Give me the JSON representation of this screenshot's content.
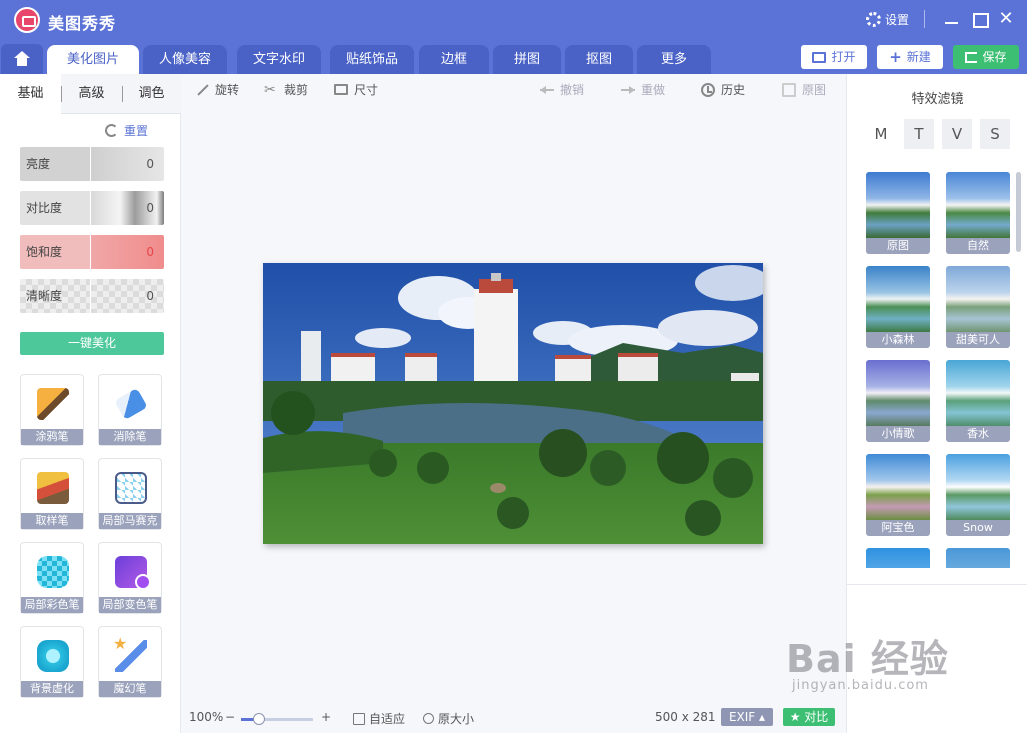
{
  "app": {
    "title": "美图秀秀",
    "settings_label": "设置",
    "close_glyph": "✕"
  },
  "tabs": [
    "美化图片",
    "人像美容",
    "文字水印",
    "贴纸饰品",
    "边框",
    "拼图",
    "抠图",
    "更多"
  ],
  "toolbar": {
    "open_label": "打开",
    "new_label": "新建",
    "save_label": "保存"
  },
  "left_panel": {
    "subtabs": [
      "基础",
      "高级",
      "调色"
    ],
    "reset_label": "重置",
    "sliders": [
      {
        "label": "亮度",
        "value": "0"
      },
      {
        "label": "对比度",
        "value": "0"
      },
      {
        "label": "饱和度",
        "value": "0"
      },
      {
        "label": "清晰度",
        "value": "0"
      }
    ],
    "beautify_label": "一键美化",
    "tools": [
      "涂鸦笔",
      "消除笔",
      "取样笔",
      "局部马赛克",
      "局部彩色笔",
      "局部变色笔",
      "背景虚化",
      "魔幻笔"
    ]
  },
  "edit_toolbar": {
    "rotate": "旋转",
    "crop": "裁剪",
    "size": "尺寸",
    "undo": "撤销",
    "redo": "重做",
    "history": "历史",
    "original": "原图"
  },
  "statusbar": {
    "zoom": "100%",
    "zoom_level": 0.25,
    "minus": "−",
    "plus": "+",
    "fit": "自适应",
    "actual_size": "原大小",
    "dimensions": "500 x 281",
    "exif": "EXIF ▴",
    "compare": "对比"
  },
  "right_panel": {
    "title": "特效滤镜",
    "filter_tabs": [
      "M",
      "T",
      "V",
      "S"
    ],
    "filters": [
      "原图",
      "自然",
      "小森林",
      "甜美可人",
      "小情歌",
      "香水",
      "阿宝色",
      "Snow",
      "",
      ""
    ]
  },
  "watermark": {
    "main": "Bai 经验",
    "sub": "jingyan.baidu.com"
  },
  "colors": {
    "brand": "#5b73d6",
    "green": "#3cbf73",
    "label_bg": "#9aa2bc"
  }
}
